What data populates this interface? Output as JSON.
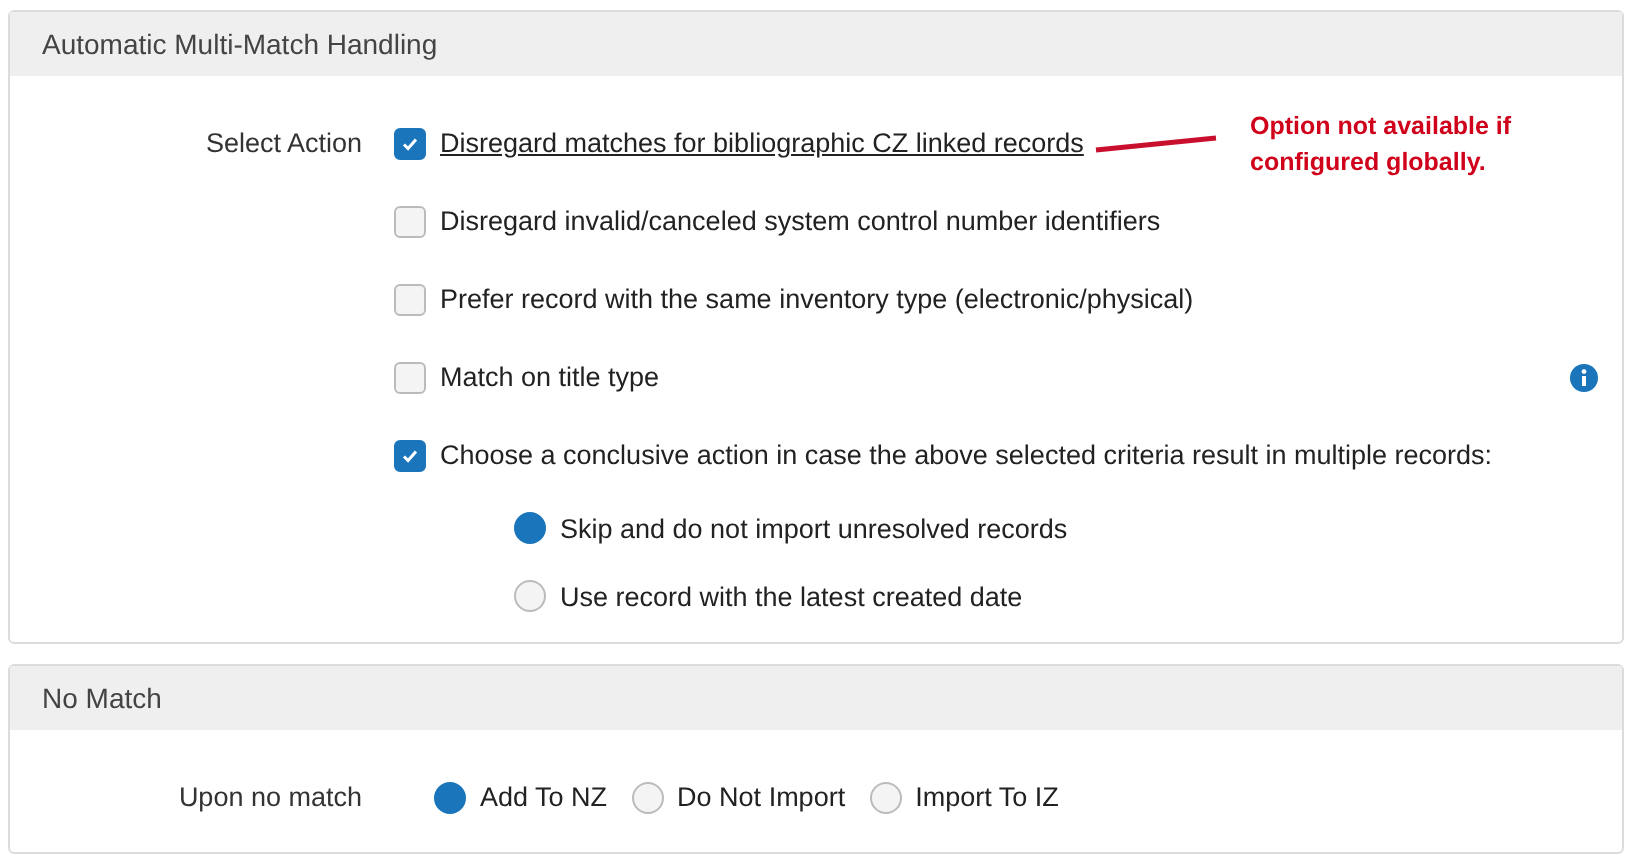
{
  "sections": [
    {
      "title": "Automatic Multi-Match Handling",
      "kind": "stacked",
      "field_label": "Select Action",
      "options": [
        {
          "kind": "checkbox",
          "label": "Disregard matches for bibliographic CZ linked records",
          "checked": true,
          "underlined": true,
          "annotation": "Option not available if configured globally."
        },
        {
          "kind": "checkbox",
          "label": "Disregard invalid/canceled system control number identifiers",
          "checked": false
        },
        {
          "kind": "checkbox",
          "label": "Prefer record with the same inventory type (electronic/physical)",
          "checked": false
        },
        {
          "kind": "checkbox",
          "label": "Match on title type",
          "checked": false,
          "info_icon": true
        },
        {
          "kind": "checkbox",
          "label": "Choose a conclusive action in case the above selected criteria result in multiple records:",
          "checked": true,
          "children": [
            {
              "kind": "radio",
              "label": "Skip and do not import unresolved records",
              "selected": true
            },
            {
              "kind": "radio",
              "label": "Use record with the latest created date",
              "selected": false
            }
          ]
        }
      ]
    },
    {
      "title": "No Match",
      "kind": "inline",
      "field_label": "Upon no match",
      "options": [
        {
          "kind": "radio",
          "label": "Add To NZ",
          "selected": true
        },
        {
          "kind": "radio",
          "label": "Do Not Import",
          "selected": false
        },
        {
          "kind": "radio",
          "label": "Import To IZ",
          "selected": false
        }
      ]
    }
  ]
}
